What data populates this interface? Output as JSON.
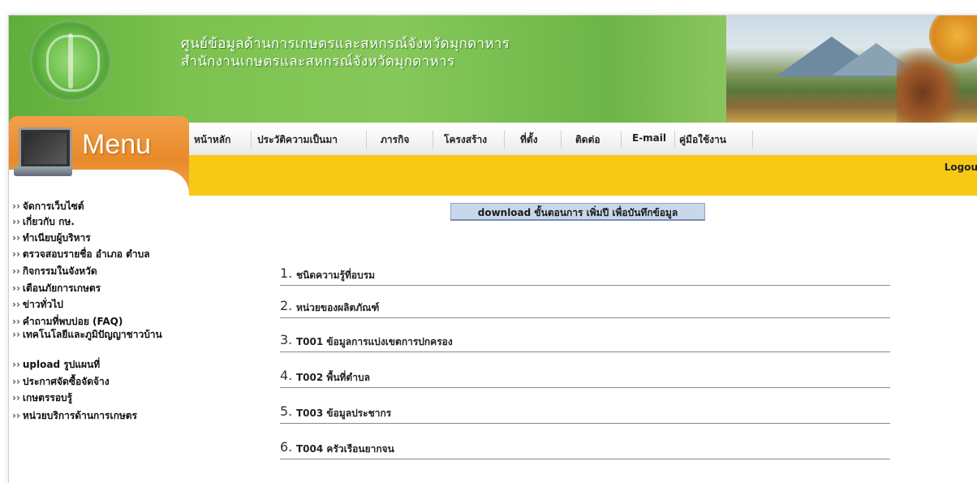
{
  "banner": {
    "title_line1": "ศูนย์ข้อมูลด้านการเกษตรและสหกรณ์จังหวัดมุกดาหาร",
    "title_line2": "สำนักงานเกษตรและสหกรณ์จังหวัดมุกดาหาร"
  },
  "menu": {
    "title": "Menu"
  },
  "nav": {
    "items": [
      "หน้าหลัก",
      "ประวัติความเป็นมา",
      "ภารกิจ",
      "โครงสร้าง",
      "ที่ตั้ง",
      "ติดต่อ",
      "E-mail",
      "คู่มือใช้งาน"
    ],
    "logout": "Logou"
  },
  "sidebar": {
    "arrow": "››",
    "items": [
      "จัดการเว็บไซต์",
      "เกี่ยวกับ กษ.",
      "ทำเนียบผู้บริหาร",
      "ตรวจสอบรายชื่อ อำเภอ ตำบล",
      "กิจกรรมในจังหวัด",
      "เตือนภัยการเกษตร",
      "ข่าวทั่วไป",
      "คำถามที่พบบ่อย (FAQ)",
      "เทคโนโลยีและภูมิปัญญาชาวบ้าน",
      "upload รูปแผนที่",
      "ประกาศจัดซื้อจัดจ้าง",
      "เกษตรรอบรู้",
      "หน่วยบริการด้านการเกษตร"
    ]
  },
  "main": {
    "download_label": "download ขั้นตอนการ เพิ่มปี เพื่อบันทึกข้อมูล",
    "items": [
      {
        "num": "1.",
        "label": "ชนิดความรู้ที่อบรม"
      },
      {
        "num": "2.",
        "label": "หน่วยของผลิตภัณฑ์"
      },
      {
        "num": "3.",
        "label": "T001 ข้อมูลการแบ่งเขตการปกครอง"
      },
      {
        "num": "4.",
        "label": "T002 พื้นที่ตำบล"
      },
      {
        "num": "5.",
        "label": "T003 ข้อมูลประชากร"
      },
      {
        "num": "6.",
        "label": "T004 ครัวเรือนยากจน"
      }
    ]
  },
  "colors": {
    "banner_green": "#7cc24f",
    "menu_orange": "#e98a2a",
    "bar_yellow": "#f7c916",
    "button_blue": "#c9d7ea"
  }
}
